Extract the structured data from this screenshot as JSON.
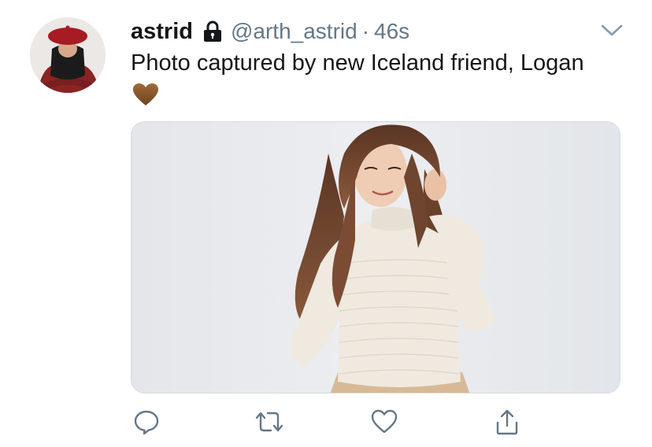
{
  "tweet": {
    "display_name": "astrid",
    "handle": "@arth_astrid",
    "separator": "·",
    "time": "46s",
    "text": "Photo captured by new Iceland friend, Logan",
    "emoji": "brown-heart-emoji",
    "protected_icon": "lock-icon"
  },
  "actions": [
    {
      "name": "reply",
      "icon": "reply-icon"
    },
    {
      "name": "retweet",
      "icon": "retweet-icon"
    },
    {
      "name": "like",
      "icon": "heart-icon"
    },
    {
      "name": "share",
      "icon": "share-icon"
    }
  ],
  "colors": {
    "text": "#14171a",
    "secondary": "#657786",
    "heart_emoji": "#8b5a2b",
    "avatar_beret": "#a11d21",
    "sweater": "#efe9df"
  }
}
